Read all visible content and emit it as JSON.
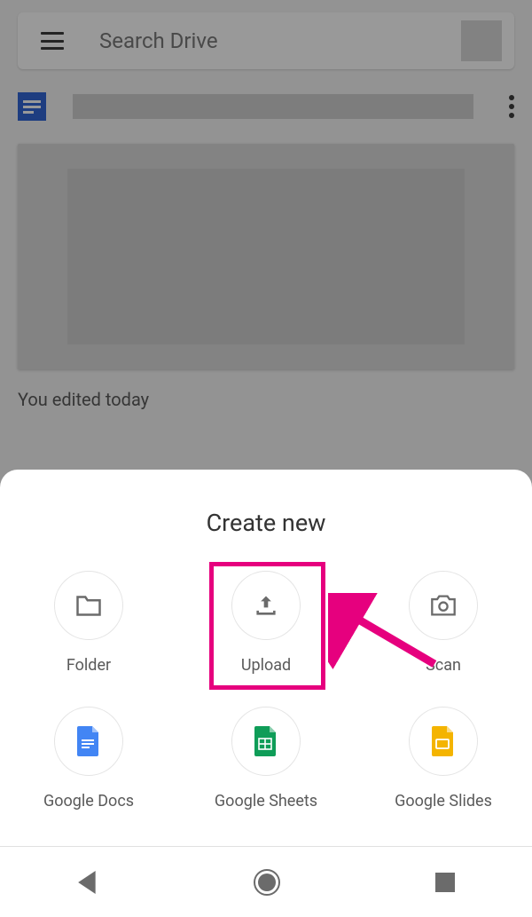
{
  "search": {
    "placeholder": "Search Drive"
  },
  "file": {
    "edited_text": "You edited today"
  },
  "sheet": {
    "title": "Create new",
    "items": [
      {
        "label": "Folder"
      },
      {
        "label": "Upload"
      },
      {
        "label": "Scan"
      },
      {
        "label": "Google Docs"
      },
      {
        "label": "Google Sheets"
      },
      {
        "label": "Google Slides"
      }
    ]
  },
  "annotation": {
    "highlighted_item": "Upload"
  }
}
